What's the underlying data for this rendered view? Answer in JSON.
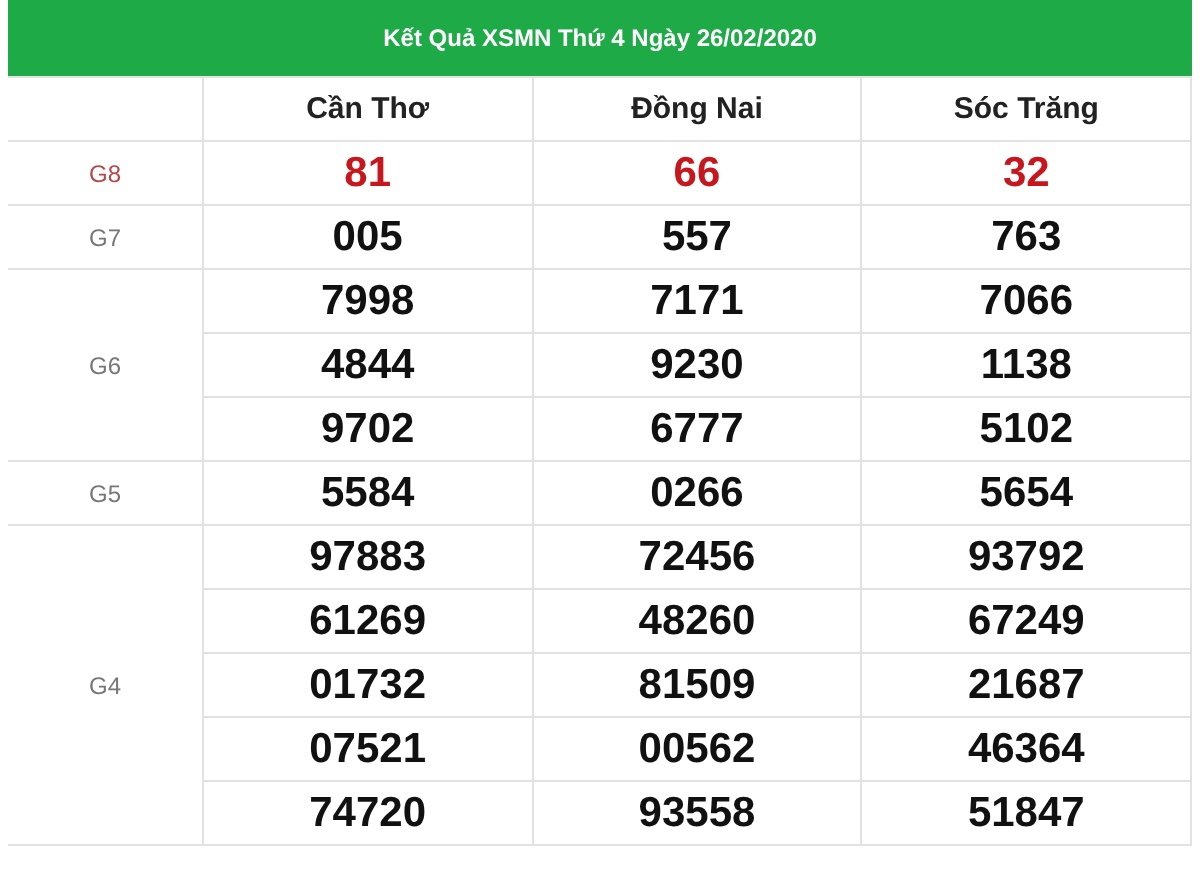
{
  "title": "Kết Quả XSMN Thứ 4 Ngày 26/02/2020",
  "columns": [
    "Cần Thơ",
    "Đồng Nai",
    "Sóc Trăng"
  ],
  "prizes": [
    {
      "label": "G8",
      "kind": "special",
      "rows": [
        [
          "81",
          "66",
          "32"
        ]
      ]
    },
    {
      "label": "G7",
      "kind": "normal",
      "rows": [
        [
          "005",
          "557",
          "763"
        ]
      ]
    },
    {
      "label": "G6",
      "kind": "normal",
      "rows": [
        [
          "7998",
          "7171",
          "7066"
        ],
        [
          "4844",
          "9230",
          "1138"
        ],
        [
          "9702",
          "6777",
          "5102"
        ]
      ]
    },
    {
      "label": "G5",
      "kind": "normal",
      "rows": [
        [
          "5584",
          "0266",
          "5654"
        ]
      ]
    },
    {
      "label": "G4",
      "kind": "normal",
      "rows": [
        [
          "97883",
          "72456",
          "93792"
        ],
        [
          "61269",
          "48260",
          "67249"
        ],
        [
          "01732",
          "81509",
          "21687"
        ],
        [
          "07521",
          "00562",
          "46364"
        ],
        [
          "74720",
          "93558",
          "51847"
        ]
      ]
    }
  ]
}
